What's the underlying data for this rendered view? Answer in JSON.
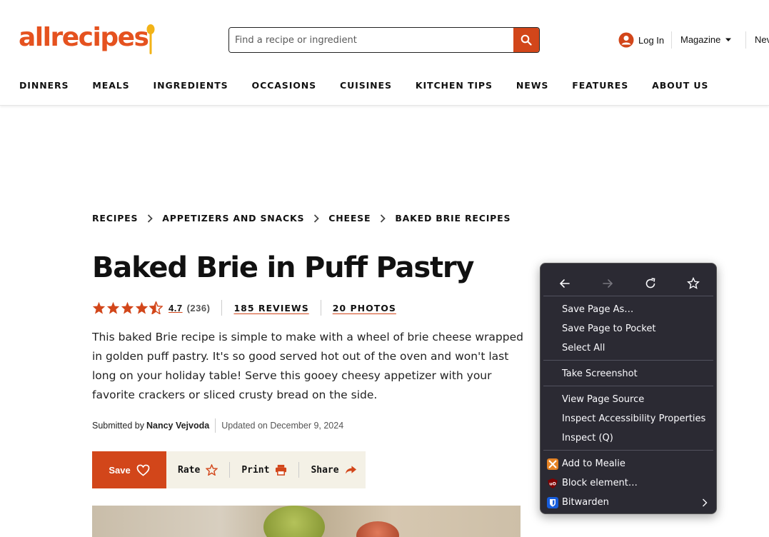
{
  "header": {
    "logo_text": "allrecipes",
    "search_placeholder": "Find a recipe or ingredient",
    "login_label": "Log In",
    "magazine_label": "Magazine",
    "news_label": "Nev"
  },
  "nav": [
    "DINNERS",
    "MEALS",
    "INGREDIENTS",
    "OCCASIONS",
    "CUISINES",
    "KITCHEN TIPS",
    "NEWS",
    "FEATURES",
    "ABOUT US"
  ],
  "breadcrumb": [
    "RECIPES",
    "APPETIZERS AND SNACKS",
    "CHEESE",
    "BAKED BRIE RECIPES"
  ],
  "recipe": {
    "title": "Baked Brie in Puff Pastry",
    "rating": "4.7",
    "rating_count": "(236)",
    "rating_stars": 4.5,
    "reviews_label": "185 REVIEWS",
    "photos_label": "20 PHOTOS",
    "description": "This baked Brie recipe is simple to make with a wheel of brie cheese wrapped in golden puff pastry. It's so good served hot out of the oven and won't last long on your holiday table! Serve this gooey cheesy appetizer with your favorite crackers or sliced crusty bread on the side.",
    "submitted_prefix": "Submitted by",
    "author": "Nancy Vejvoda",
    "updated": "Updated on December 9, 2024"
  },
  "actions": {
    "save": "Save",
    "rate": "Rate",
    "print": "Print",
    "share": "Share"
  },
  "context_menu": {
    "save_page_as": "Save Page As…",
    "save_to_pocket": "Save Page to Pocket",
    "select_all": "Select All",
    "take_screenshot": "Take Screenshot",
    "view_source": "View Page Source",
    "inspect_accessibility": "Inspect Accessibility Properties",
    "inspect": "Inspect (Q)",
    "add_to_mealie": "Add to Mealie",
    "block_element": "Block element…",
    "bitwarden": "Bitwarden"
  },
  "colors": {
    "brand": "#e5521f",
    "brand_dark": "#d2461a",
    "menu_bg": "#2b2a33",
    "action_bar_bg": "#f4f1e6"
  }
}
